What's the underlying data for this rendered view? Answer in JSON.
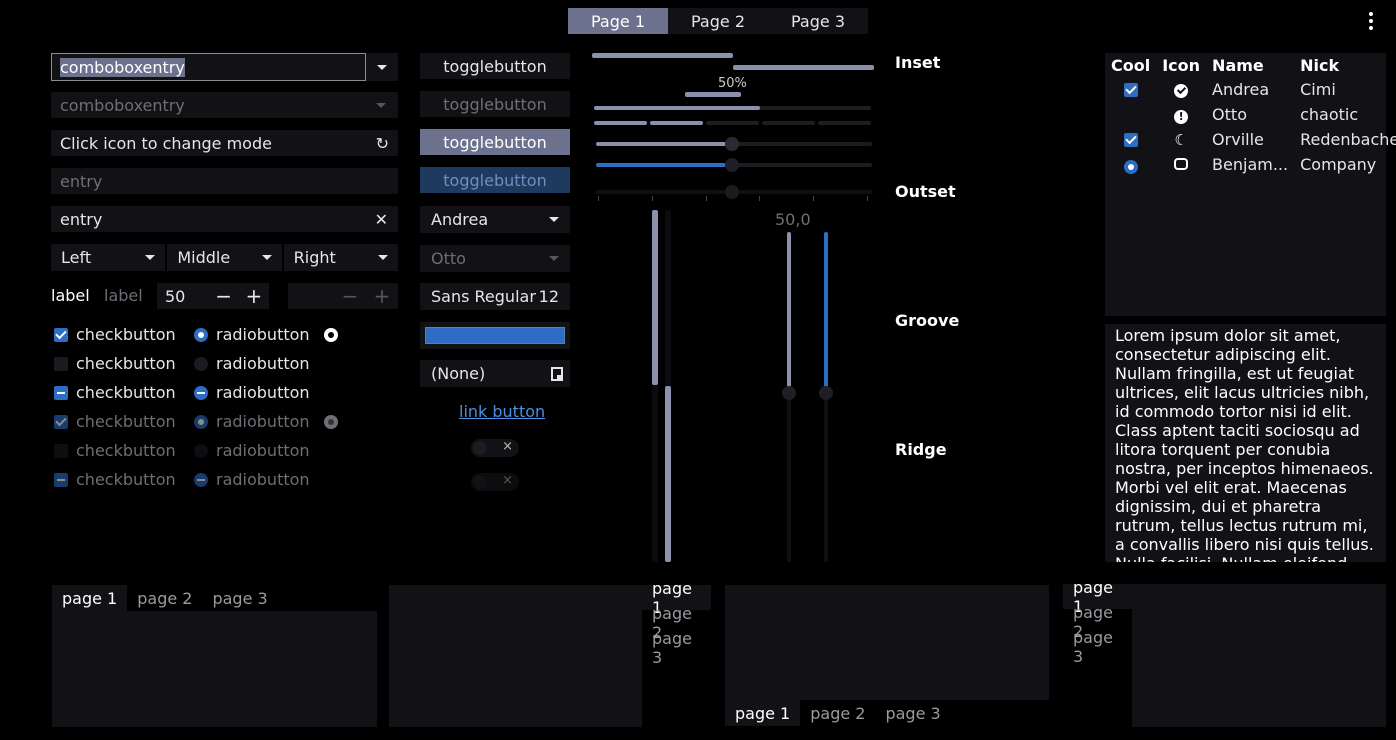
{
  "top_tabs": [
    "Page 1",
    "Page 2",
    "Page 3"
  ],
  "left": {
    "combo1_value": "comboboxentry",
    "combo2_value": "comboboxentry",
    "mode_entry_value": "Click icon to change mode",
    "entry_placeholder": "entry",
    "entry_value": "entry",
    "linked_buttons": [
      "Left",
      "Middle",
      "Right"
    ],
    "label1": "label",
    "label2": "label",
    "spin_value": "50",
    "checks": [
      "checkbutton",
      "checkbutton",
      "checkbutton",
      "checkbutton",
      "checkbutton",
      "checkbutton"
    ],
    "radios": [
      "radiobutton",
      "radiobutton",
      "radiobutton",
      "radiobutton",
      "radiobutton",
      "radiobutton"
    ]
  },
  "mid": {
    "toggles": [
      "togglebutton",
      "togglebutton",
      "togglebutton",
      "togglebutton"
    ],
    "combo_andrea": "Andrea",
    "combo_otto": "Otto",
    "font_name": "Sans Regular",
    "font_size": "12",
    "file_none": "(None)",
    "link_label": "link button",
    "switch_off_mark": "×"
  },
  "sliders": {
    "progress_label": "50%",
    "vscale_value": "50,0",
    "progress1": 0.5,
    "progress2": 0.5,
    "scale1": 0.5,
    "scale2": 0.5,
    "accent": "#2d6ec4"
  },
  "frames": [
    "Inset",
    "Outset",
    "Groove",
    "Ridge"
  ],
  "tree": {
    "headers": [
      "Cool",
      "Icon",
      "Name",
      "Nick"
    ],
    "rows": [
      {
        "cool": "check",
        "icon": "check-circle-icon",
        "name": "Andrea",
        "nick": "Cimi"
      },
      {
        "cool": "none",
        "icon": "alert-circle-icon",
        "name": "Otto",
        "nick": "chaotic"
      },
      {
        "cool": "check",
        "icon": "moon-icon",
        "name": "Orville",
        "nick": "Redenbacher"
      },
      {
        "cool": "radio",
        "icon": "robot-icon",
        "name": "Benjam...",
        "nick": "Company"
      }
    ]
  },
  "text_view": "Lorem ipsum dolor sit amet, consectetur adipiscing elit.\nNullam fringilla, est ut feugiat ultrices, elit lacus ultricies nibh, id commodo tortor nisi id elit.\nClass aptent taciti sociosqu ad litora torquent per conubia nostra, per inceptos himenaeos.\nMorbi vel elit erat. Maecenas dignissim, dui et pharetra rutrum, tellus lectus rutrum mi, a convallis libero nisi quis tellus.\nNulla facilisi. Nullam eleifend lobortis",
  "notebooks": {
    "tabs": [
      "page 1",
      "page 2",
      "page 3"
    ]
  },
  "header_menu_icon": "vertical-dots-icon"
}
